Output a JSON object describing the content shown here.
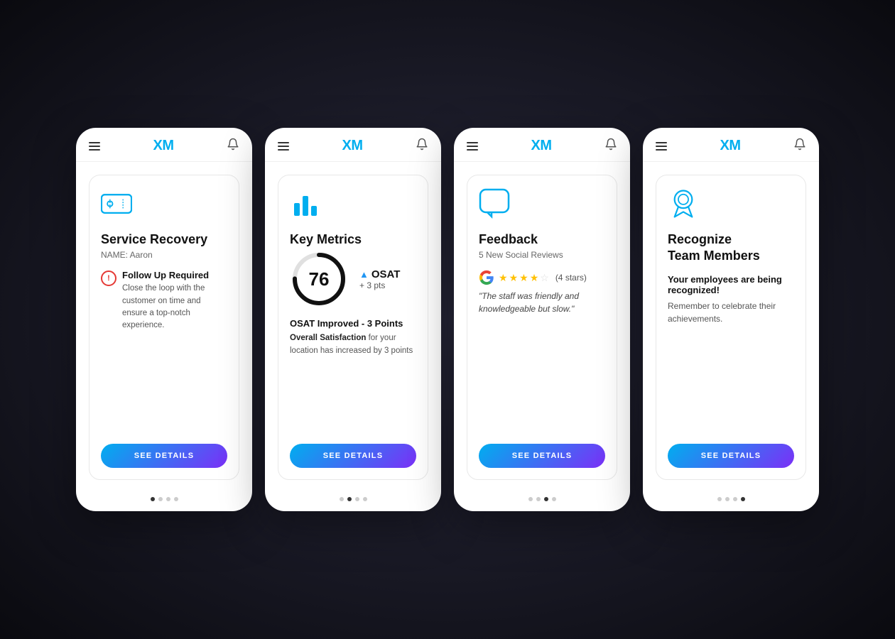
{
  "cards": [
    {
      "id": "service-recovery",
      "topbar": {
        "logo": "XM",
        "bell": "🔔"
      },
      "icon_type": "ticket",
      "title": "Service Recovery",
      "subtitle": "NAME: Aaron",
      "alert": {
        "title": "Follow Up Required",
        "body": "Close the loop with the customer on time and ensure a top-notch experience."
      },
      "button_label": "SEE DETAILS",
      "dots": [
        true,
        false,
        false,
        false
      ]
    },
    {
      "id": "key-metrics",
      "topbar": {
        "logo": "XM",
        "bell": "🔔"
      },
      "icon_type": "bar",
      "title": "Key Metrics",
      "subtitle": null,
      "gauge": {
        "value": 76,
        "label": "OSAT",
        "delta": "+ 3 pts"
      },
      "improved_title": "OSAT Improved - 3 Points",
      "improved_body_strong": "Overall Satisfaction",
      "improved_body_rest": " for your location has increased by 3 points",
      "button_label": "SEE DETAILS",
      "dots": [
        false,
        true,
        false,
        false
      ]
    },
    {
      "id": "feedback",
      "topbar": {
        "logo": "XM",
        "bell": "🔔"
      },
      "icon_type": "chat",
      "title": "Feedback",
      "subtitle": "5 New Social Reviews",
      "review": {
        "stars": 4,
        "label": "(4 stars)",
        "text": "\"The staff was friendly and knowledgeable but slow.\""
      },
      "button_label": "SEE DETAILS",
      "dots": [
        false,
        false,
        true,
        false
      ]
    },
    {
      "id": "recognize-team",
      "topbar": {
        "logo": "XM",
        "bell": "🔔"
      },
      "icon_type": "ribbon",
      "title": "Recognize\nTeam Members",
      "subtitle": null,
      "recognition": {
        "bold": "Your employees are being recognized!",
        "body": "Remember to celebrate their achievements."
      },
      "button_label": "SEE DETAILS",
      "dots": [
        false,
        false,
        false,
        true
      ]
    }
  ]
}
